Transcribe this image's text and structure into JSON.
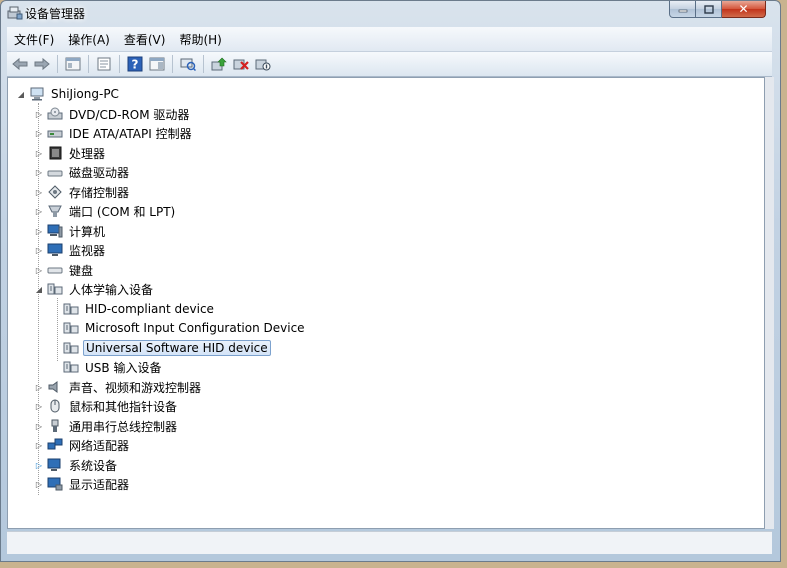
{
  "window": {
    "title": "设备管理器"
  },
  "menu": [
    {
      "label": "文件(F)"
    },
    {
      "label": "操作(A)"
    },
    {
      "label": "查看(V)"
    },
    {
      "label": "帮助(H)"
    }
  ],
  "toolbar": {
    "icons": [
      "back-icon",
      "forward-icon",
      "show-hide-console-tree-icon",
      "properties-icon",
      "help-icon",
      "action-pane-icon",
      "scan-hardware-icon",
      "update-driver-icon",
      "uninstall-icon",
      "disable-icon"
    ]
  },
  "tree": {
    "root": "ShiJiong-PC",
    "categories": [
      {
        "label": "DVD/CD-ROM 驱动器"
      },
      {
        "label": "IDE ATA/ATAPI 控制器"
      },
      {
        "label": "处理器"
      },
      {
        "label": "磁盘驱动器"
      },
      {
        "label": "存储控制器"
      },
      {
        "label": "端口 (COM 和 LPT)"
      },
      {
        "label": "计算机"
      },
      {
        "label": "监视器"
      },
      {
        "label": "键盘"
      },
      {
        "label": "人体学输入设备"
      }
    ],
    "hid_children": [
      {
        "label": "HID-compliant device"
      },
      {
        "label": "Microsoft Input Configuration Device"
      },
      {
        "label": "Universal Software HID device"
      },
      {
        "label": "USB 输入设备"
      }
    ],
    "categories_after": [
      {
        "label": "声音、视频和游戏控制器"
      },
      {
        "label": "鼠标和其他指针设备"
      },
      {
        "label": "通用串行总线控制器"
      },
      {
        "label": "网络适配器"
      },
      {
        "label": "系统设备"
      },
      {
        "label": "显示适配器"
      }
    ],
    "selected": "Universal Software HID device"
  }
}
